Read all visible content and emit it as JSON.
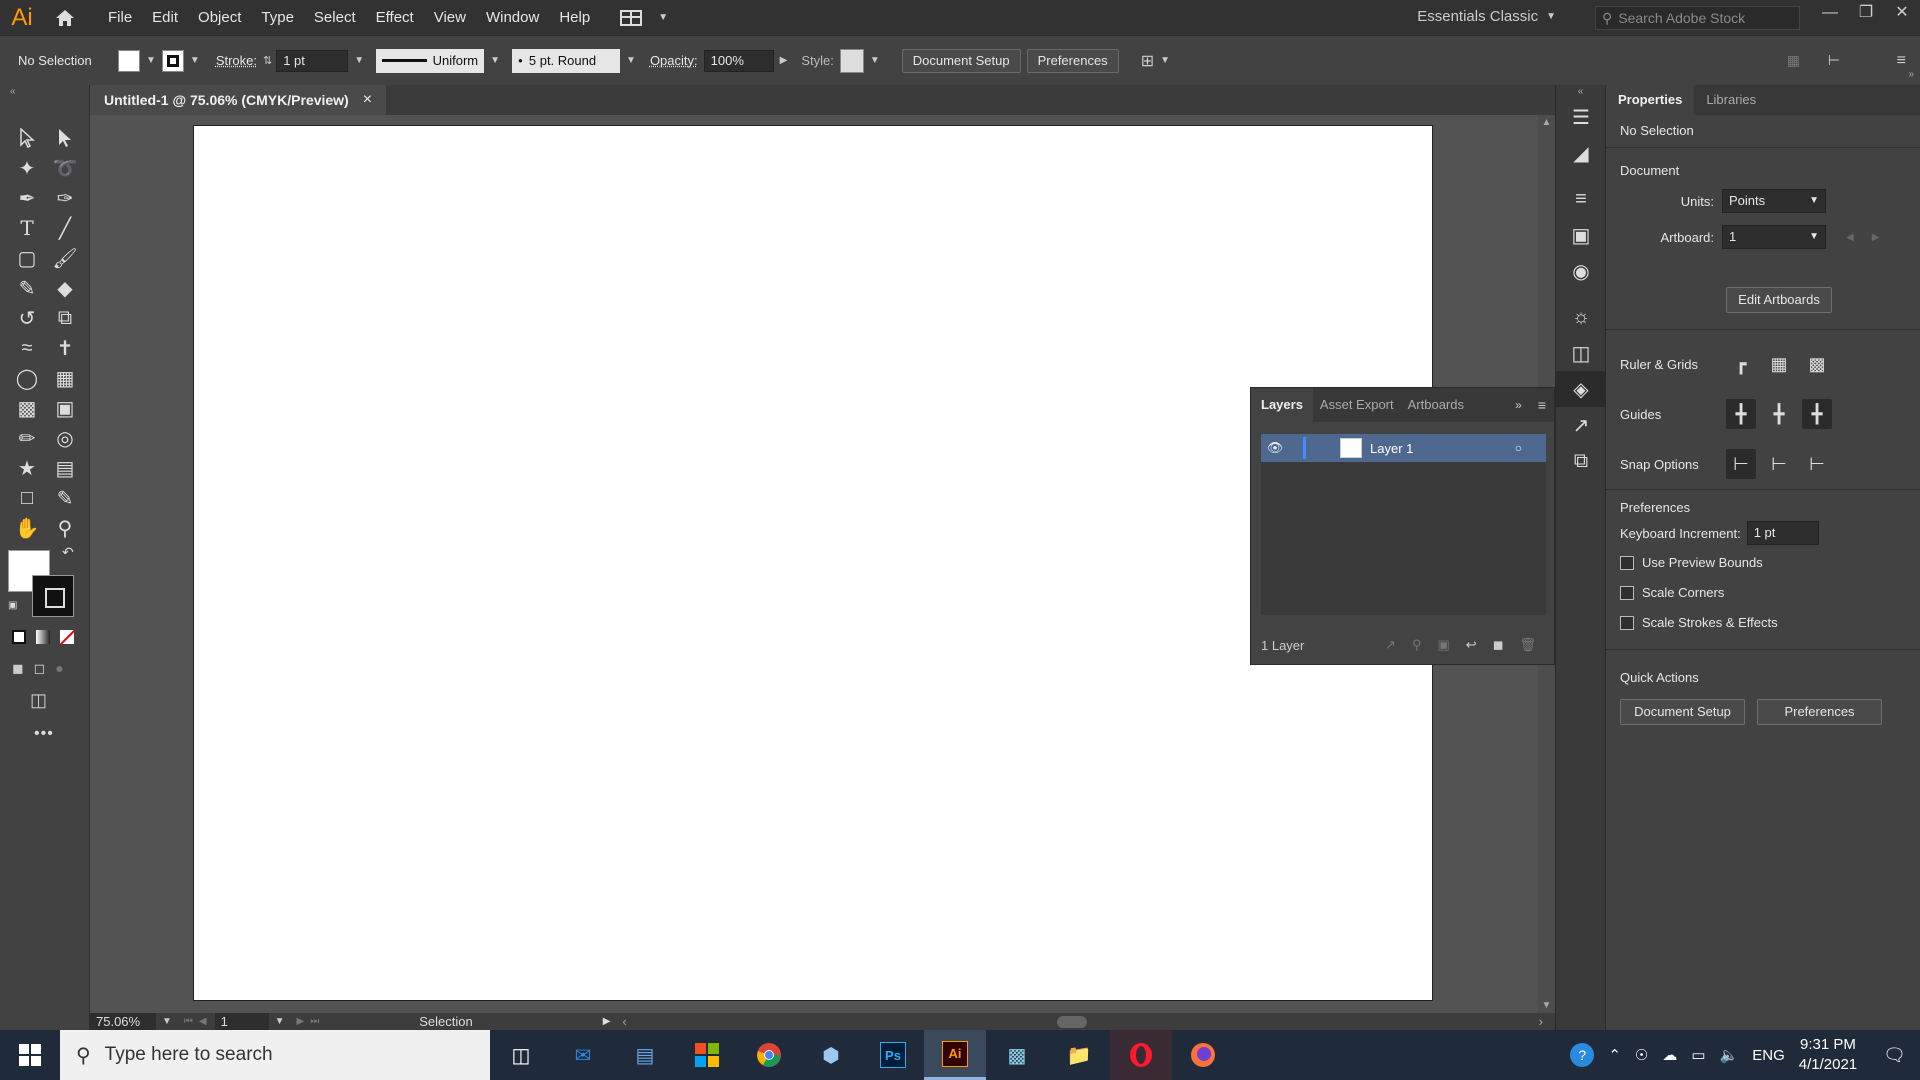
{
  "app": {
    "logo": "Ai",
    "menu": [
      "File",
      "Edit",
      "Object",
      "Type",
      "Select",
      "Effect",
      "View",
      "Window",
      "Help"
    ],
    "workspace": "Essentials Classic",
    "search_placeholder": "Search Adobe Stock"
  },
  "controlbar": {
    "selection": "No Selection",
    "stroke_label": "Stroke:",
    "stroke_value": "1 pt",
    "stroke_profile": "Uniform",
    "brush": "5 pt. Round",
    "opacity_label": "Opacity:",
    "opacity_value": "100%",
    "style_label": "Style:",
    "document_setup": "Document Setup",
    "preferences": "Preferences"
  },
  "document": {
    "tab_title": "Untitled-1 @ 75.06% (CMYK/Preview)",
    "close": "×"
  },
  "status": {
    "zoom": "75.06%",
    "artboard": "1",
    "tool": "Selection"
  },
  "layers_panel": {
    "tabs": [
      "Layers",
      "Asset Export",
      "Artboards"
    ],
    "layer_name": "Layer 1",
    "count": "1 Layer"
  },
  "properties": {
    "tabs": [
      "Properties",
      "Libraries"
    ],
    "selection": "No Selection",
    "document_heading": "Document",
    "units_label": "Units:",
    "units_value": "Points",
    "artboard_label": "Artboard:",
    "artboard_value": "1",
    "edit_artboards": "Edit Artboards",
    "ruler_grids": "Ruler & Grids",
    "guides": "Guides",
    "snap_options": "Snap Options",
    "preferences_heading": "Preferences",
    "keyboard_increment_label": "Keyboard Increment:",
    "keyboard_increment_value": "1 pt",
    "use_preview_bounds": "Use Preview Bounds",
    "scale_corners": "Scale Corners",
    "scale_strokes": "Scale Strokes & Effects",
    "quick_actions": "Quick Actions",
    "document_setup": "Document Setup",
    "preferences": "Preferences"
  },
  "taskbar": {
    "search_placeholder": "Type here to search",
    "language": "ENG",
    "time": "9:31 PM",
    "date": "4/1/2021",
    "ps_label": "Ps",
    "ai_label": "Ai"
  }
}
